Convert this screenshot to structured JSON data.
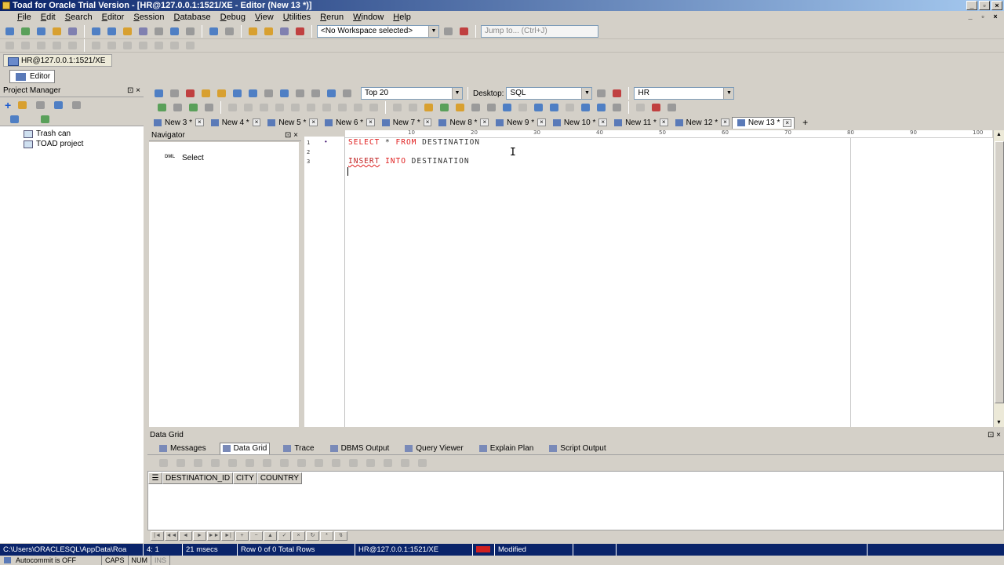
{
  "window": {
    "title": "Toad for Oracle Trial Version - [HR@127.0.0.1:1521/XE - Editor (New 13 *)]"
  },
  "menu": [
    "File",
    "Edit",
    "Search",
    "Editor",
    "Session",
    "Database",
    "Debug",
    "View",
    "Utilities",
    "Rerun",
    "Window",
    "Help"
  ],
  "toolbar": {
    "workspace": "<No Workspace selected>",
    "jump": "Jump to... (Ctrl+J)"
  },
  "connection_tab": "HR@127.0.0.1:1521/XE",
  "editor_tab": "Editor",
  "project_manager": {
    "title": "Project Manager",
    "items": [
      "Trash can",
      "TOAD project"
    ]
  },
  "navigator": {
    "title": "Navigator",
    "item": "Select",
    "item_tag": "DML"
  },
  "editor_toolbar": {
    "rows": "Top 20",
    "desktop_label": "Desktop:",
    "desktop": "SQL",
    "schema": "HR"
  },
  "doc_tabs": [
    "New 3 *",
    "New 4 *",
    "New 5 *",
    "New 6 *",
    "New 7 *",
    "New 8 *",
    "New 9 *",
    "New 10 *",
    "New 11 *",
    "New 12 *",
    "New 13 *"
  ],
  "active_tab_index": 10,
  "ruler": [
    "10",
    "20",
    "30",
    "40",
    "50",
    "60",
    "70",
    "80",
    "90",
    "100"
  ],
  "code": {
    "line_numbers": [
      "1",
      "2",
      "3"
    ],
    "line1_kw1": "SELECT",
    "line1_rest1": " * ",
    "line1_kw2": "FROM",
    "line1_rest2": " DESTINATION",
    "line3_kw1": "INSERT",
    "line3_rest1": " ",
    "line3_kw2": "INTO",
    "line3_rest2": " DESTINATION"
  },
  "data_grid": {
    "title": "Data Grid",
    "tabs": [
      "Messages",
      "Data Grid",
      "Trace",
      "DBMS Output",
      "Query Viewer",
      "Explain Plan",
      "Script Output"
    ],
    "columns": [
      "DESTINATION_ID",
      "CITY",
      "COUNTRY"
    ]
  },
  "status": {
    "path": "C:\\Users\\ORACLESQL\\AppData\\Roa",
    "pos": "4:  1",
    "time": "21 msecs",
    "rows": "Row 0 of 0 Total Rows",
    "conn": "HR@127.0.0.1:1521/XE",
    "state": "Modified",
    "autocommit": "Autocommit is OFF",
    "caps": "CAPS",
    "num": "NUM",
    "ins": "INS"
  },
  "colors": {
    "title": "#0a246a",
    "keyword": "#e02020",
    "status_bg": "#0a246a"
  }
}
